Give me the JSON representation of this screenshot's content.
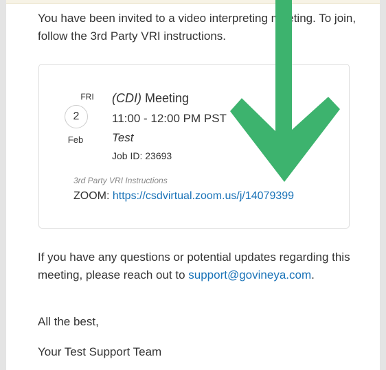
{
  "email": {
    "intro_text": "You have been invited to a video interpreting meeting. To join, follow the 3rd Party VRI instructions.",
    "meeting": {
      "day_of_week": "FRI",
      "day": "2",
      "month": "Feb",
      "title_tag": "(CDI)",
      "title": "Meeting",
      "time": "11:00 - 12:00 PM PST",
      "project": "Test",
      "job_id_label": "Job ID:",
      "job_id": "23693",
      "vri_label": "3rd Party VRI Instructions",
      "zoom_label": "ZOOM:",
      "zoom_link": "https://csdvirtual.zoom.us/j/14079399"
    },
    "questions_text": "If you have any questions or potential updates regarding this meeting, please reach out to",
    "support_email": "support@govineya.com",
    "closing": "All the best,",
    "signature": "Your Test Support Team"
  },
  "colors": {
    "link": "#1a73b8",
    "arrow": "#3db36e",
    "text": "#333333"
  },
  "icons": [
    "down-arrow-overlay-icon"
  ]
}
